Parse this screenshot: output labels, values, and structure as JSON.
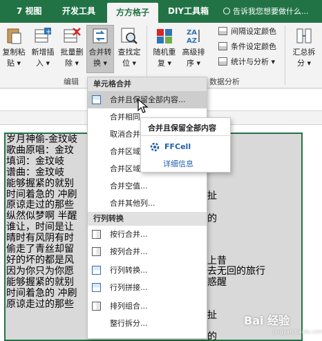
{
  "tabs": [
    "7 视图",
    "开发工具",
    "方方格子",
    "DIY工具箱"
  ],
  "tell_me": "告诉我您想要做什么...",
  "ribbon": {
    "buttons": [
      {
        "line1": "复制粘",
        "line2": "贴 ▾"
      },
      {
        "line1": "新增插",
        "line2": "入 ▾"
      },
      {
        "line1": "批量删",
        "line2": "除 ▾"
      },
      {
        "line1": "合并转",
        "line2": "换 ▾"
      },
      {
        "line1": "查找定",
        "line2": "位 ▾"
      },
      {
        "line1": "随机重",
        "line2": "复 ▾"
      },
      {
        "line1": "高级排",
        "line2": "序 ▾"
      },
      {
        "line1": "汇总拆",
        "line2": "分 ▾"
      }
    ],
    "small_items": [
      "间隔设定颜色",
      "条件设定颜色",
      "统计与分析 ▾"
    ],
    "group_edit": "编辑",
    "group_data": "数据分析"
  },
  "menu": {
    "header1": "单元格合并",
    "items1": [
      "合并且保留全部内容...",
      "合并相同",
      "取消合并",
      "合并区域",
      "合并区域",
      "合并空值...",
      "合并其他列..."
    ],
    "header2": "行列转换",
    "items2": [
      "按行合并...",
      "按列合并...",
      "行列转换...",
      "行列拼接...",
      "排列组合...",
      "整行拆分..."
    ]
  },
  "tooltip": {
    "title": "合并且保留全部内容",
    "brand": "FFCell",
    "link": "详细信息"
  },
  "sheet": {
    "lines": [
      "岁月神偷-金玟岐",
      "歌曲原唱：金玟",
      "填词：金玟岐",
      "谱曲：金玟岐",
      "能够握紧的就别",
      "时间着急的 冲刷",
      "原谅走过的那些",
      "纵然似梦啊 半醒",
      "谁让，时间是让",
      "晴时有风阴有时",
      "偷走了青丝却留",
      "好的坏的都是风",
      "因为你只为你愿",
      "能够握紧的就别",
      "时间着急的 冲刷",
      "原谅走过的那些"
    ],
    "fragments": [
      "扯",
      "的",
      "去无回的旅行",
      "惑醒",
      "扯",
      "的"
    ],
    "frag_line2": "去无回的旅行"
  },
  "watermark": "Bai 经验",
  "watermark_sub": "jingyan.baidu.com"
}
